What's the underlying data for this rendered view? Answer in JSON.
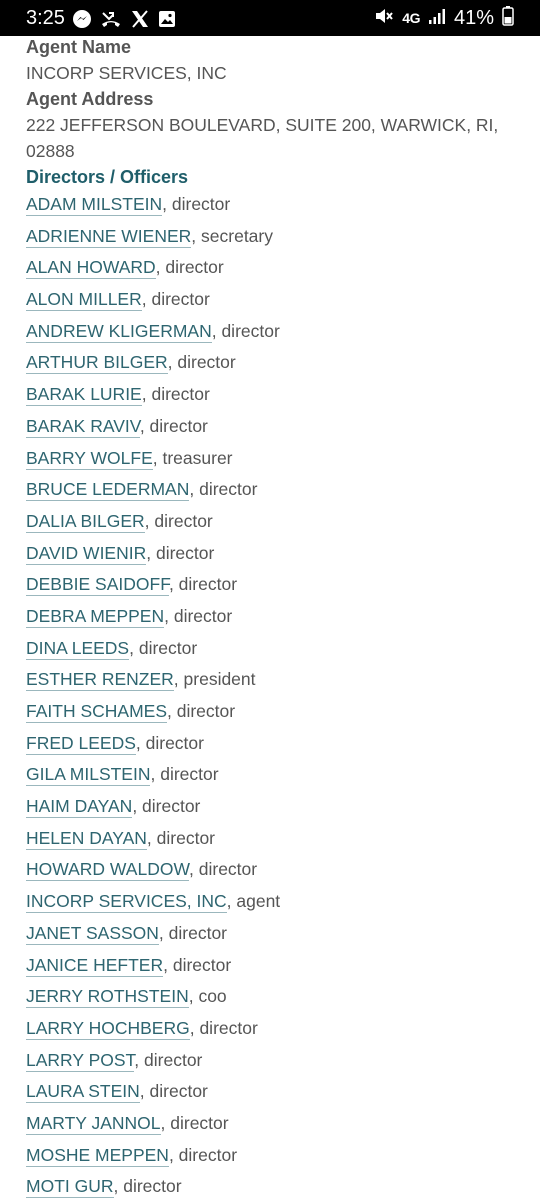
{
  "status_bar": {
    "time": "3:25",
    "network": "4G",
    "battery": "41%",
    "icons_left": [
      "messenger-icon",
      "missed-call-icon",
      "x-icon",
      "image-icon"
    ],
    "icons_right": [
      "mute-icon",
      "network-4g-icon",
      "signal-icon",
      "battery-icon"
    ]
  },
  "agent": {
    "name_label": "Agent Name",
    "name": "INCORP SERVICES, INC",
    "address_label": "Agent Address",
    "address_line1": "222 JEFFERSON BOULEVARD, SUITE 200, WARWICK, RI,",
    "address_line2": "02888"
  },
  "directors": {
    "heading": "Directors / Officers",
    "items": [
      {
        "name": "ADAM MILSTEIN",
        "role": ", director"
      },
      {
        "name": "ADRIENNE WIENER",
        "role": ", secretary"
      },
      {
        "name": "ALAN HOWARD",
        "role": ", director"
      },
      {
        "name": "ALON MILLER",
        "role": ", director"
      },
      {
        "name": "ANDREW KLIGERMAN",
        "role": ", director"
      },
      {
        "name": "ARTHUR BILGER",
        "role": ", director"
      },
      {
        "name": "BARAK LURIE",
        "role": ", director"
      },
      {
        "name": "BARAK RAVIV",
        "role": ", director"
      },
      {
        "name": "BARRY WOLFE",
        "role": ", treasurer"
      },
      {
        "name": "BRUCE LEDERMAN",
        "role": ", director"
      },
      {
        "name": "DALIA BILGER",
        "role": ", director"
      },
      {
        "name": "DAVID WIENIR",
        "role": ", director"
      },
      {
        "name": "DEBBIE SAIDOFF",
        "role": ", director"
      },
      {
        "name": "DEBRA MEPPEN",
        "role": ", director"
      },
      {
        "name": "DINA LEEDS",
        "role": ", director"
      },
      {
        "name": "ESTHER RENZER",
        "role": ", president"
      },
      {
        "name": "FAITH SCHAMES",
        "role": ", director"
      },
      {
        "name": "FRED LEEDS",
        "role": ", director"
      },
      {
        "name": "GILA MILSTEIN",
        "role": ", director"
      },
      {
        "name": "HAIM DAYAN",
        "role": ", director"
      },
      {
        "name": "HELEN DAYAN",
        "role": ", director"
      },
      {
        "name": "HOWARD WALDOW",
        "role": ", director"
      },
      {
        "name": "INCORP SERVICES, INC",
        "role": ", agent"
      },
      {
        "name": "JANET SASSON",
        "role": ", director"
      },
      {
        "name": "JANICE HEFTER",
        "role": ", director"
      },
      {
        "name": "JERRY ROTHSTEIN",
        "role": ", coo"
      },
      {
        "name": "LARRY HOCHBERG",
        "role": ", director"
      },
      {
        "name": "LARRY POST",
        "role": ", director"
      },
      {
        "name": "LAURA STEIN",
        "role": ", director"
      },
      {
        "name": "MARTY JANNOL",
        "role": ", director"
      },
      {
        "name": "MOSHE MEPPEN",
        "role": ", director"
      },
      {
        "name": "MOTI GUR",
        "role": ", director"
      }
    ]
  },
  "colors": {
    "heading": "#1f5e6a",
    "link": "#2e6570",
    "text": "#555555"
  }
}
